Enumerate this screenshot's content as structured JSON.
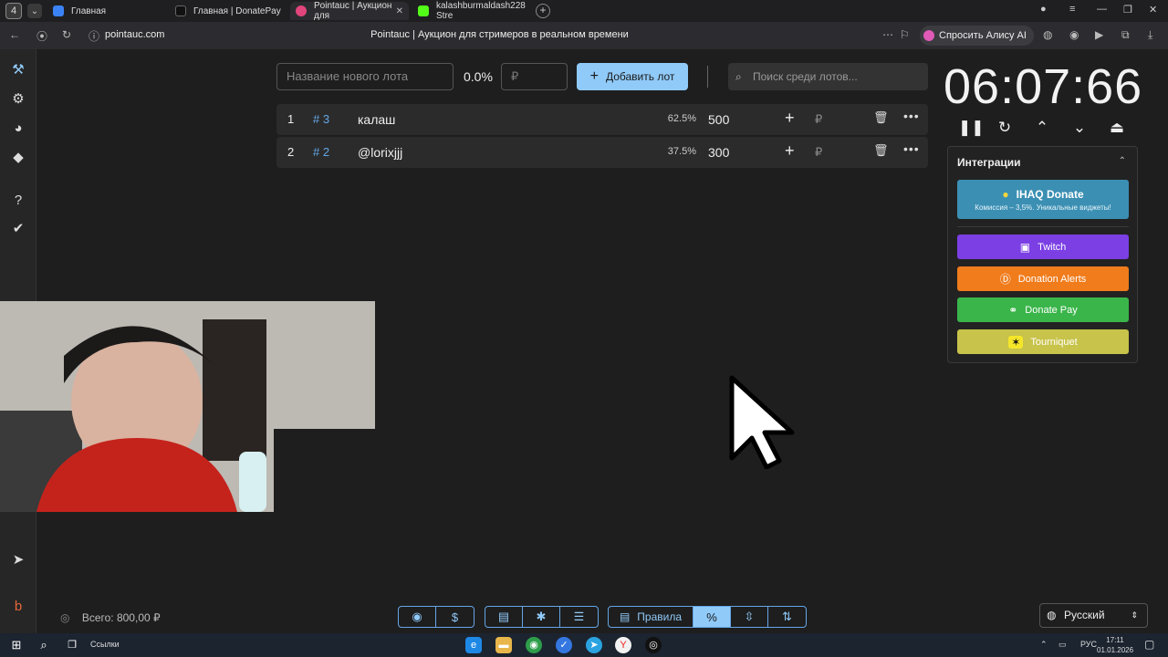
{
  "browser": {
    "tab_count": "4",
    "tabs": [
      {
        "title": "Главная",
        "favicon_color": "#3b82f6"
      },
      {
        "title": "Главная | DonatePay",
        "favicon_color": "#111111"
      },
      {
        "title": "Pointauc | Аукцион для",
        "favicon_color": "#e0457b"
      },
      {
        "title": "kalashburmaldash228 Stre",
        "favicon_color": "#53fc18"
      }
    ],
    "url": "pointauc.com",
    "page_title": "Pointauc | Аукцион для стримеров в реальном времени",
    "alice_label": "Спросить Алису AI"
  },
  "toolbar": {
    "lot_placeholder": "Название нового лота",
    "percent": "0.0%",
    "amount_placeholder": "₽",
    "add_label": "Добавить лот",
    "search_placeholder": "Поиск среди лотов..."
  },
  "lots": [
    {
      "index": "1",
      "id": "# 3",
      "name": "калаш",
      "percent": "62.5%",
      "amount": "500",
      "currency": "₽"
    },
    {
      "index": "2",
      "id": "# 2",
      "name": "@lorixjjj",
      "percent": "37.5%",
      "amount": "300",
      "currency": "₽"
    }
  ],
  "timer": {
    "value": "06:07:66"
  },
  "integrations": {
    "title": "Интеграции",
    "ihaq_title": "IHAQ Donate",
    "ihaq_sub": "Комиссия – 3,5%. Уникальные виджеты!",
    "buttons": [
      {
        "label": "Twitch",
        "color": "#7b3fe4",
        "icon": "twitch-icon"
      },
      {
        "label": "Donation Alerts",
        "color": "#f07c1c",
        "icon": "donation-alerts-icon"
      },
      {
        "label": "Donate Pay",
        "color": "#3ab54a",
        "icon": "donatepay-icon"
      },
      {
        "label": "Tourniquet",
        "color": "#c8c34a",
        "icon": "tourniquet-icon"
      }
    ]
  },
  "footer": {
    "total": "Всего: 800,00 ₽",
    "rules_label": "Правила",
    "language": "Русский"
  },
  "taskbar": {
    "links_label": "Ссылки",
    "lang": "РУС",
    "time": "17:11",
    "date": "01.01.2026"
  }
}
